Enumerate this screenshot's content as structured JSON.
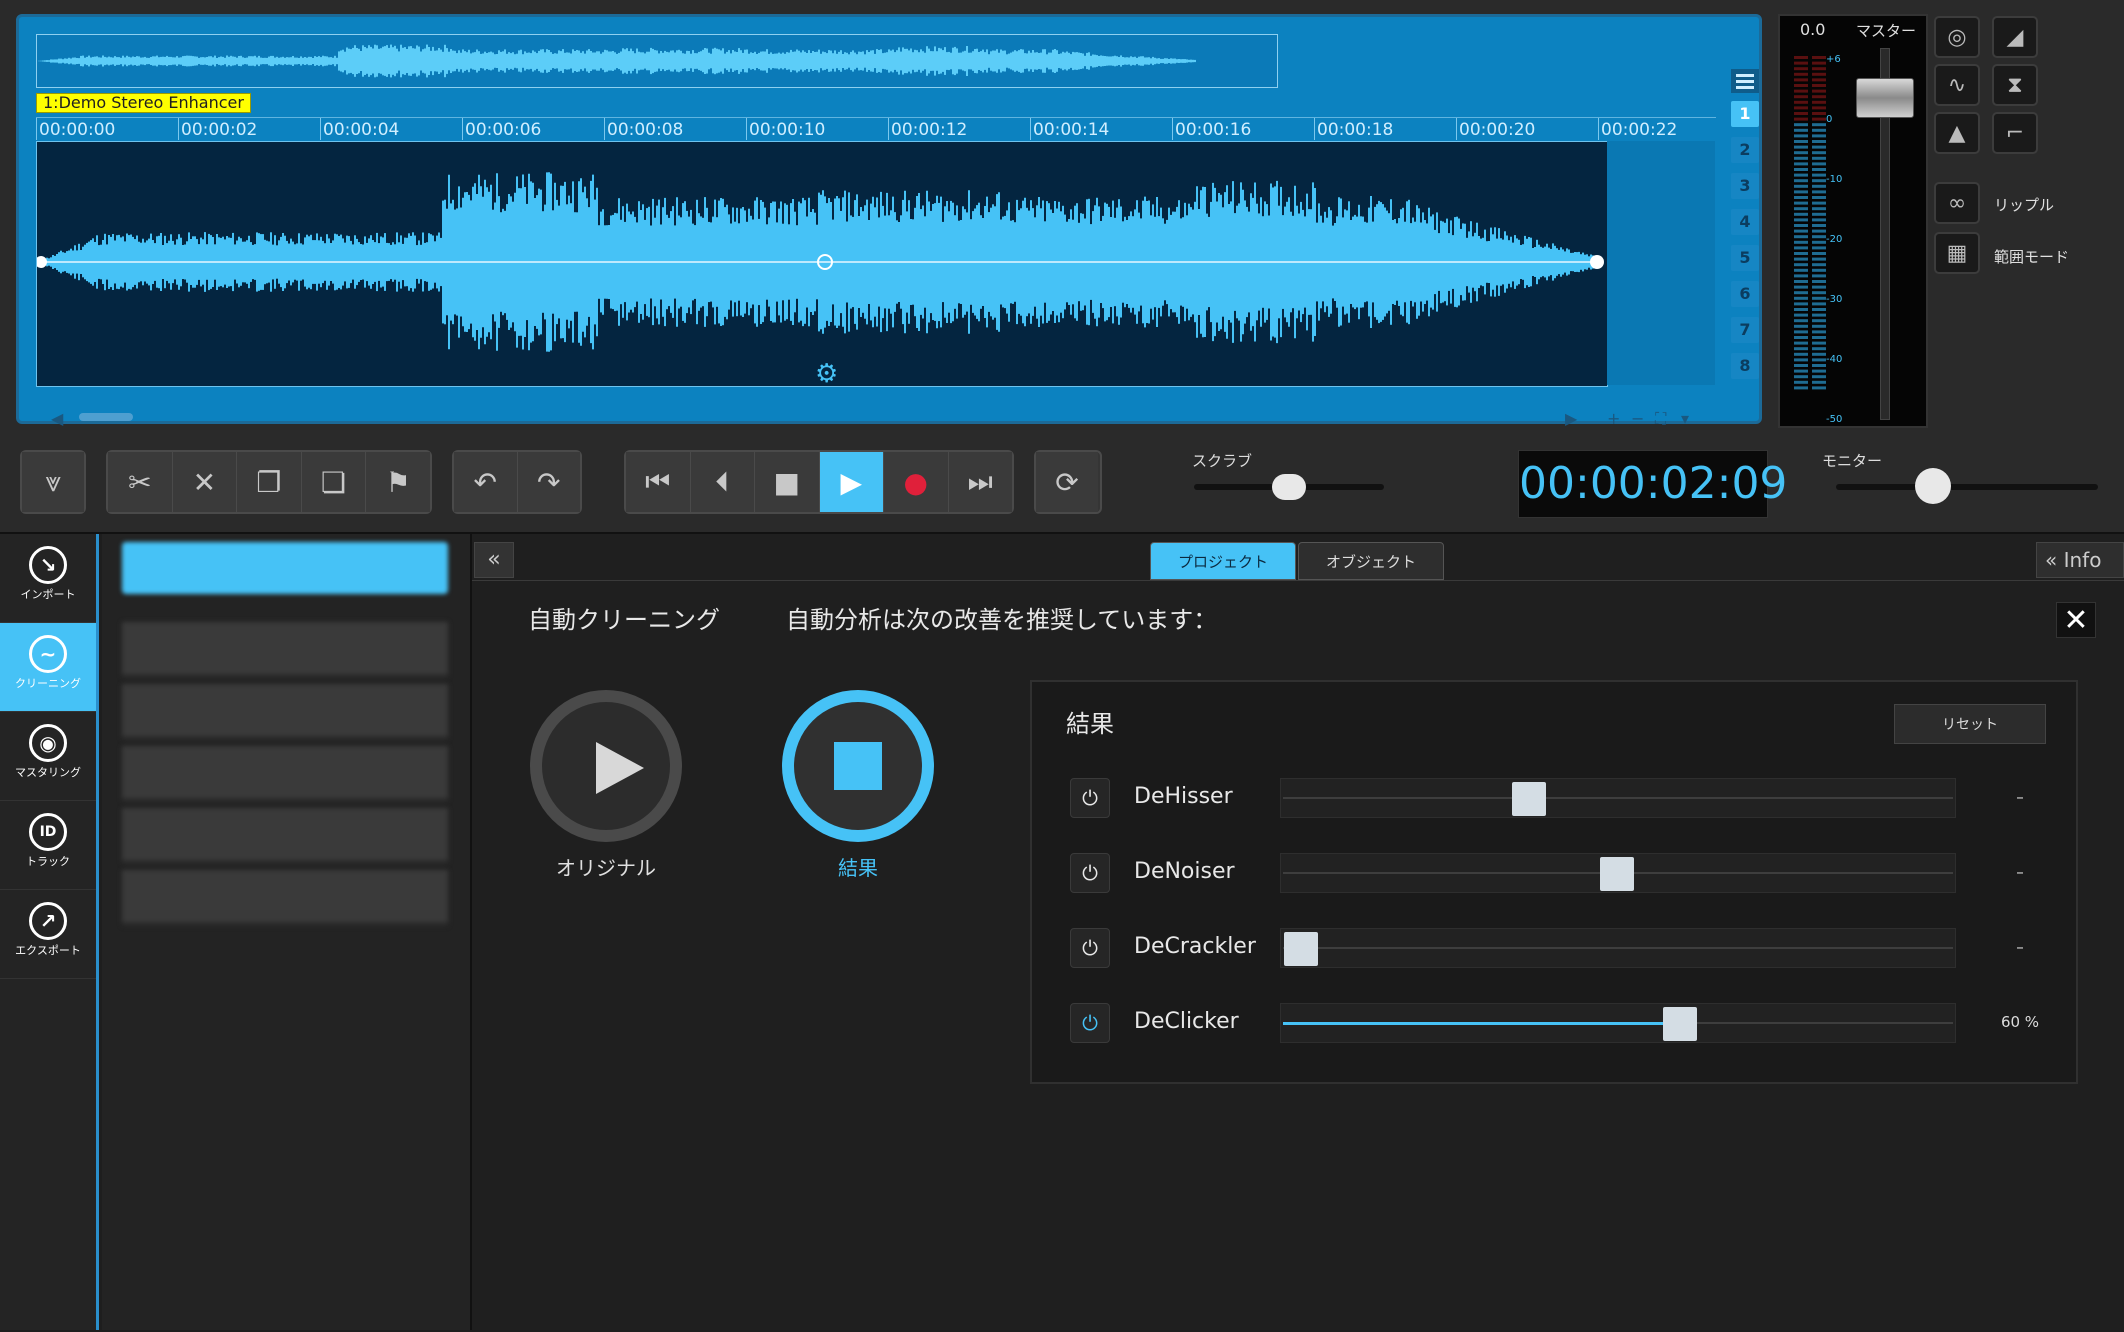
{
  "track": {
    "label": "1:Demo Stereo Enhancer"
  },
  "ruler": {
    "ticks": [
      "00:00:00",
      "00:00:02",
      "00:00:04",
      "00:00:06",
      "00:00:08",
      "00:00:10",
      "00:00:12",
      "00:00:14",
      "00:00:16",
      "00:00:18",
      "00:00:20",
      "00:00:22"
    ]
  },
  "layers": [
    "1",
    "2",
    "3",
    "4",
    "5",
    "6",
    "7",
    "8"
  ],
  "master": {
    "value": "0.0",
    "label": "マスター",
    "db_marks": [
      "+6",
      "0",
      "-10",
      "-20",
      "-30",
      "-40",
      "-50"
    ],
    "fader_level": 0.92
  },
  "side_buttons": {
    "ripple": "リップル",
    "range_mode": "範囲モード"
  },
  "scrub": {
    "label": "スクラブ",
    "level": 0.5
  },
  "monitor": {
    "label": "モニター",
    "level": 0.37
  },
  "time_display": "00:00:02:09",
  "nav": [
    {
      "id": "import",
      "label": "インポート"
    },
    {
      "id": "cleaning",
      "label": "クリーニング"
    },
    {
      "id": "mastering",
      "label": "マスタリング"
    },
    {
      "id": "track",
      "label": "トラック"
    },
    {
      "id": "export",
      "label": "エクスポート"
    }
  ],
  "tabs": {
    "project": "プロジェクト",
    "object": "オブジェクト",
    "info": "Info"
  },
  "auto": {
    "title": "自動クリーニング",
    "message": "自動分析は次の改善を推奨しています：",
    "original_label": "オリジナル",
    "result_label": "結果"
  },
  "results": {
    "title": "結果",
    "reset_label": "リセット",
    "rows": [
      {
        "name": "DeHisser",
        "value": "–",
        "level": 0.36,
        "active": false
      },
      {
        "name": "DeNoiser",
        "value": "–",
        "level": 0.5,
        "active": false
      },
      {
        "name": "DeCrackler",
        "value": "–",
        "level": 0.0,
        "active": false
      },
      {
        "name": "DeClicker",
        "value": "60 %",
        "level": 0.6,
        "active": true
      }
    ]
  },
  "colors": {
    "accent": "#46c2f6",
    "panel_blue": "#0c82c0",
    "record": "#e0203a"
  }
}
